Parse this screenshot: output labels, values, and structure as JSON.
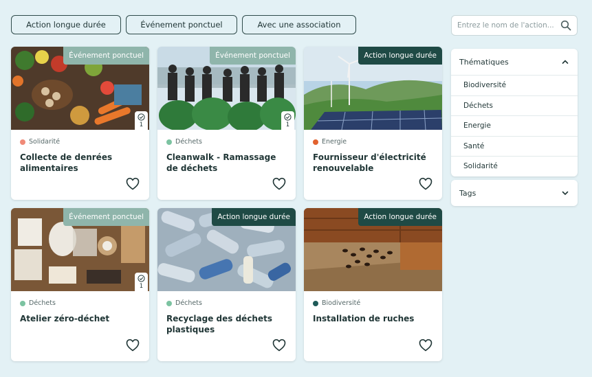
{
  "filters": [
    {
      "label": "Action longue durée"
    },
    {
      "label": "Événement ponctuel"
    },
    {
      "label": "Avec une association"
    }
  ],
  "search": {
    "placeholder": "Entrez le nom de l'action..."
  },
  "cards": [
    {
      "badge": "Événement ponctuel",
      "badge_type": "ponctuel",
      "count": "1",
      "category": "Solidarité",
      "category_color": "#f08a78",
      "title": "Collecte de denrées alimentaires"
    },
    {
      "badge": "Événement ponctuel",
      "badge_type": "ponctuel",
      "count": "1",
      "category": "Déchets",
      "category_color": "#7cc3a1",
      "title": "Cleanwalk - Ramassage de déchets"
    },
    {
      "badge": "Action longue durée",
      "badge_type": "longue",
      "category": "Energie",
      "category_color": "#e2622f",
      "title": "Fournisseur d'électricité renouvelable"
    },
    {
      "badge": "Événement ponctuel",
      "badge_type": "ponctuel",
      "count": "1",
      "category": "Déchets",
      "category_color": "#7cc3a1",
      "title": "Atelier zéro-déchet"
    },
    {
      "badge": "Action longue durée",
      "badge_type": "longue",
      "category": "Déchets",
      "category_color": "#7cc3a1",
      "title": "Recyclage des déchets plastiques"
    },
    {
      "badge": "Action longue durée",
      "badge_type": "longue",
      "category": "Biodiversité",
      "category_color": "#1f5a58",
      "title": "Installation de ruches"
    }
  ],
  "sidebar": {
    "thematiques": {
      "label": "Thématiques",
      "items": [
        "Biodiversité",
        "Déchets",
        "Energie",
        "Santé",
        "Solidarité"
      ]
    },
    "tags": {
      "label": "Tags"
    }
  },
  "icons": {
    "search": "search-icon",
    "check": "check-circle-icon",
    "heart": "heart-outline-icon",
    "chevron_up": "chevron-up-icon",
    "chevron_down": "chevron-down-icon"
  }
}
